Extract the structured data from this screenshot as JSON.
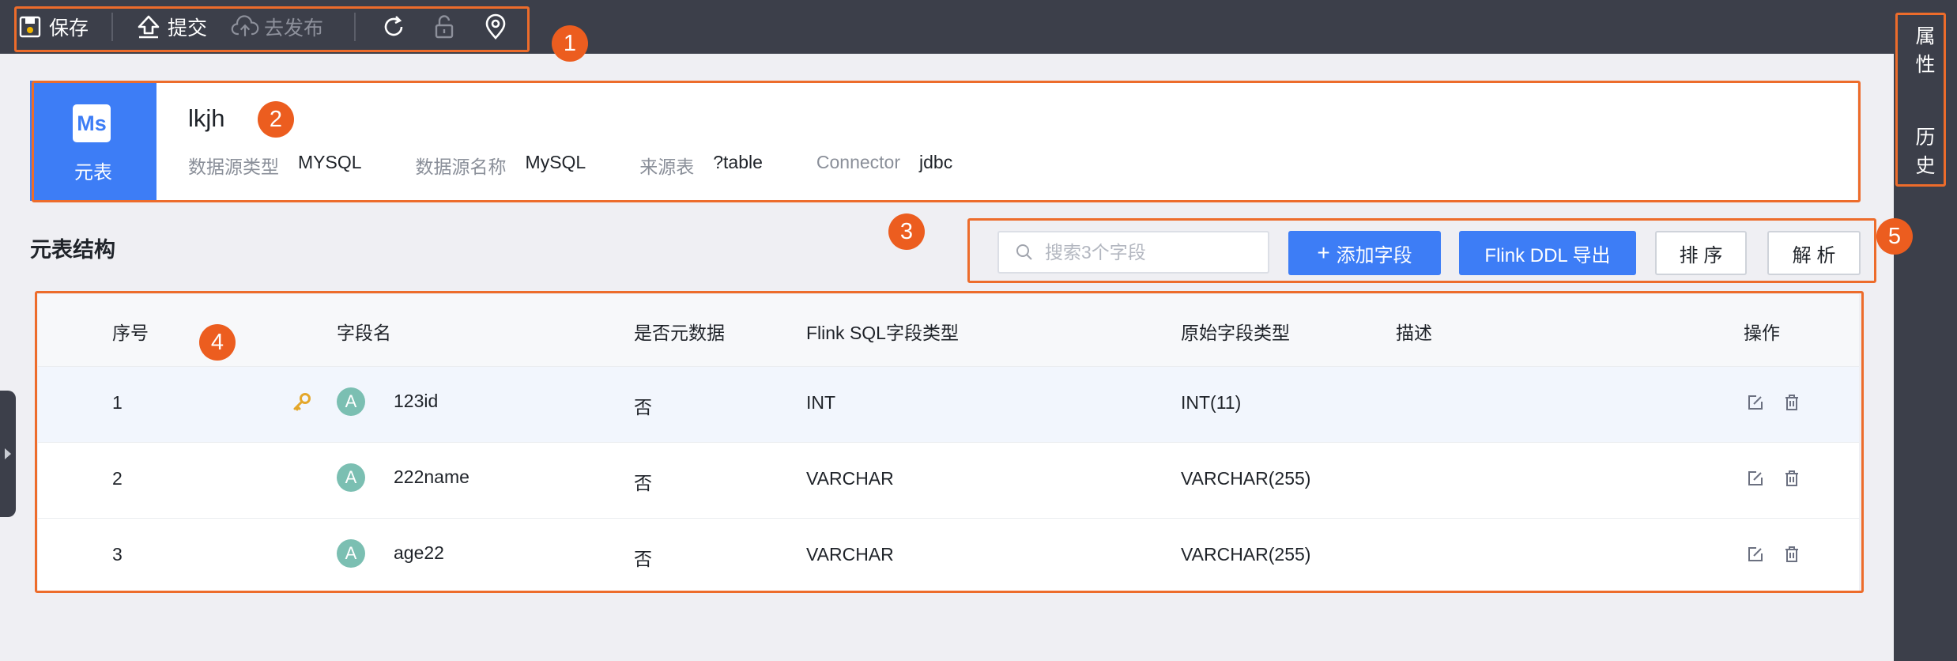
{
  "toolbar": {
    "save": "保存",
    "submit": "提交",
    "publish": "去发布",
    "refresh_icon": "refresh-icon",
    "lock_icon": "lock-icon",
    "locate_icon": "location-pin-icon"
  },
  "rail": {
    "properties": "属性",
    "history": "历史"
  },
  "meta_card": {
    "logo_text": "Ms",
    "type_label": "元表",
    "title": "lkjh",
    "fields": [
      {
        "key": "数据源类型",
        "value": "MYSQL"
      },
      {
        "key": "数据源名称",
        "value": "MySQL"
      },
      {
        "key": "来源表",
        "value": "?table"
      },
      {
        "key": "Connector",
        "value": "jdbc"
      }
    ]
  },
  "structure": {
    "title": "元表结构",
    "search_placeholder": "搜索3个字段",
    "add_field": "添加字段",
    "export_ddl": "Flink DDL 导出",
    "sort": "排 序",
    "parse": "解 析"
  },
  "table": {
    "headers": {
      "index": "序号",
      "field_name": "字段名",
      "is_meta": "是否元数据",
      "flink_type": "Flink SQL字段类型",
      "raw_type": "原始字段类型",
      "desc": "描述",
      "ops": "操作"
    },
    "rows": [
      {
        "index": "1",
        "avatar": "A",
        "name": "123id",
        "is_meta": "否",
        "flink_type": "INT",
        "raw_type": "INT(11)",
        "desc": "",
        "primary_key": true
      },
      {
        "index": "2",
        "avatar": "A",
        "name": "222name",
        "is_meta": "否",
        "flink_type": "VARCHAR",
        "raw_type": "VARCHAR(255)",
        "desc": "",
        "primary_key": false
      },
      {
        "index": "3",
        "avatar": "A",
        "name": "age22",
        "is_meta": "否",
        "flink_type": "VARCHAR",
        "raw_type": "VARCHAR(255)",
        "desc": "",
        "primary_key": false
      }
    ]
  },
  "annotations": [
    "1",
    "2",
    "3",
    "4",
    "5"
  ],
  "colors": {
    "primary": "#3d7df6",
    "toolbar_bg": "#3c3f4a",
    "annotation": "#ed6c2b",
    "avatar": "#7bbfb2",
    "key": "#e4a72b"
  }
}
